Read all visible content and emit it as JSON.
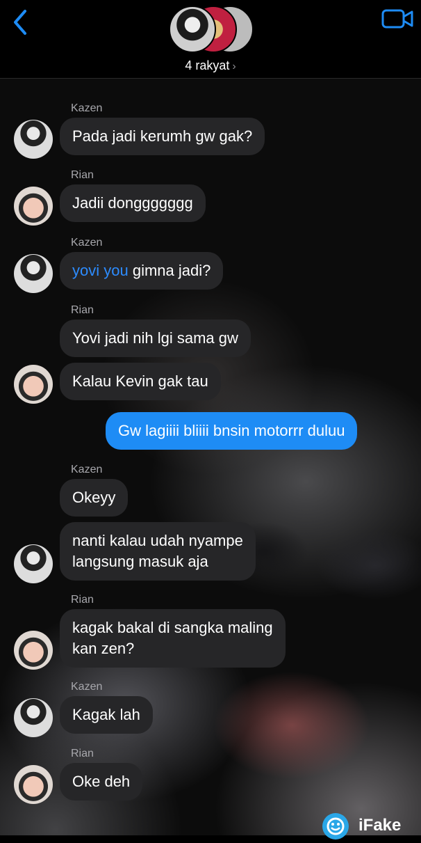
{
  "header": {
    "group_name": "4 rakyat",
    "chevron": "›",
    "back_icon": "chevron-left-icon",
    "video_icon": "video-camera-icon",
    "accent": "#1e8cf5"
  },
  "messages": [
    {
      "sender": "Kazen",
      "text": "Pada jadi kerumh gw gak?"
    },
    {
      "sender": "Rian",
      "text": "Jadii donggggggg"
    },
    {
      "sender": "Kazen",
      "mention": "yovi you",
      "text": " gimna jadi?"
    },
    {
      "sender": "Rian",
      "text": "Yovi jadi nih lgi sama gw"
    },
    {
      "text": "Kalau Kevin gak tau"
    },
    {
      "outgoing": true,
      "text": "Gw lagiiii bliiii bnsin motorrr duluu"
    },
    {
      "sender": "Kazen",
      "text": "Okeyy"
    },
    {
      "line1": "nanti kalau udah nyampe",
      "line2": "langsung masuk aja"
    },
    {
      "sender": "Rian",
      "line1": "kagak bakal di sangka maling",
      "line2": "kan zen?"
    },
    {
      "sender": "Kazen",
      "text": "Kagak lah"
    },
    {
      "sender": "Rian",
      "text": "Oke deh"
    }
  ],
  "watermark": {
    "text": "iFake"
  }
}
